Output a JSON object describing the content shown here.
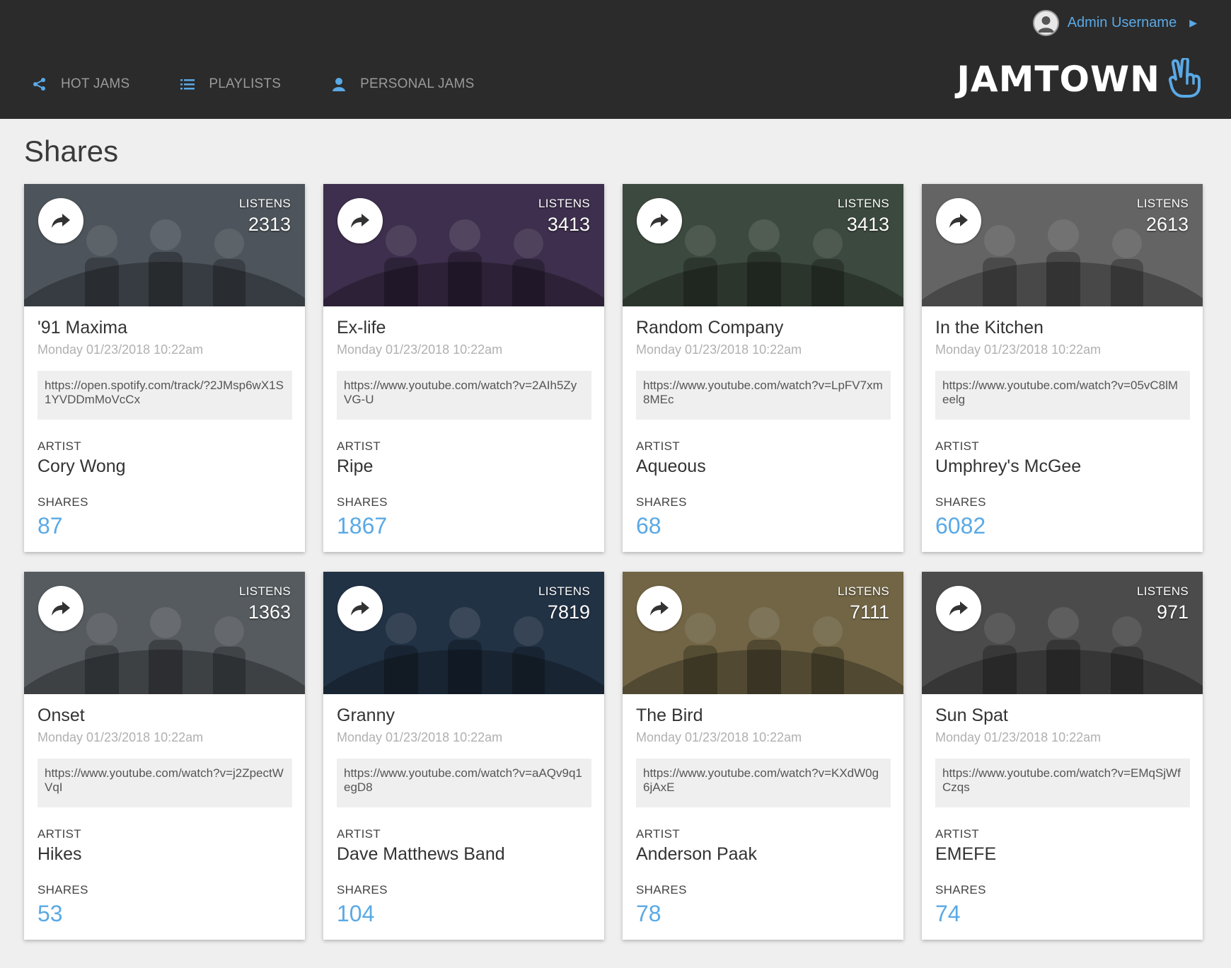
{
  "header": {
    "user_name": "Admin Username",
    "nav": [
      {
        "label": "HOT JAMS",
        "icon": "share-icon"
      },
      {
        "label": "PLAYLISTS",
        "icon": "list-icon"
      },
      {
        "label": "PERSONAL JAMS",
        "icon": "person-icon"
      }
    ],
    "logo_text": "JAMTOWN",
    "logo_icon": "peace-hand-icon"
  },
  "page": {
    "title": "Shares"
  },
  "labels": {
    "listens": "LISTENS",
    "artist": "ARTIST",
    "shares": "SHARES"
  },
  "colors": {
    "accent": "#5aa9e6",
    "header_bg": "#2b2b2b",
    "page_bg": "#efefef"
  },
  "cards": [
    {
      "title": "'91 Maxima",
      "date": "Monday 01/23/2018 10:22am",
      "url": "https://open.spotify.com/track/?2JMsp6wX1S1YVDDmMoVcCx",
      "artist": "Cory Wong",
      "listens": "2313",
      "shares": "87",
      "photo_tone": "#5e6770"
    },
    {
      "title": "Ex-life",
      "date": "Monday 01/23/2018 10:22am",
      "url": "https://www.youtube.com/watch?v=2AIh5ZyVG-U",
      "artist": "Ripe",
      "listens": "3413",
      "shares": "1867",
      "photo_tone": "#4b3a5e"
    },
    {
      "title": "Random Company",
      "date": "Monday 01/23/2018 10:22am",
      "url": "https://www.youtube.com/watch?v=LpFV7xm8MEc",
      "artist": "Aqueous",
      "listens": "3413",
      "shares": "68",
      "photo_tone": "#4a5a4c"
    },
    {
      "title": "In the Kitchen",
      "date": "Monday 01/23/2018 10:22am",
      "url": "https://www.youtube.com/watch?v=05vC8lMeelg",
      "artist": "Umphrey's McGee",
      "listens": "2613",
      "shares": "6082",
      "photo_tone": "#7a7a7a"
    },
    {
      "title": "Onset",
      "date": "Monday 01/23/2018 10:22am",
      "url": "https://www.youtube.com/watch?v=j2ZpectWVqI",
      "artist": "Hikes",
      "listens": "1363",
      "shares": "53",
      "photo_tone": "#6a6f75"
    },
    {
      "title": "Granny",
      "date": "Monday 01/23/2018 10:22am",
      "url": "https://www.youtube.com/watch?v=aAQv9q1egD8",
      "artist": "Dave Matthews Band",
      "listens": "7819",
      "shares": "104",
      "photo_tone": "#2a3d55"
    },
    {
      "title": "The Bird",
      "date": "Monday 01/23/2018 10:22am",
      "url": "https://www.youtube.com/watch?v=KXdW0g6jAxE",
      "artist": "Anderson Paak",
      "listens": "7111",
      "shares": "78",
      "photo_tone": "#8a7c55"
    },
    {
      "title": "Sun Spat",
      "date": "Monday 01/23/2018 10:22am",
      "url": "https://www.youtube.com/watch?v=EMqSjWfCzqs",
      "artist": "EMEFE",
      "listens": "971",
      "shares": "74",
      "photo_tone": "#5c5c5c"
    }
  ]
}
